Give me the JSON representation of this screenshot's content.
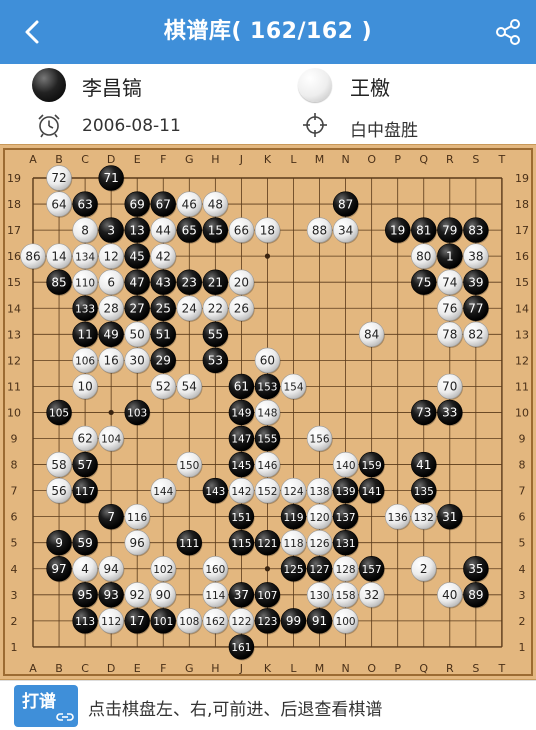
{
  "header": {
    "title": "棋谱库( 162/162 )",
    "back_icon": "chevron-left-icon",
    "share_icon": "share-icon"
  },
  "players": {
    "black": {
      "name": "李昌镐"
    },
    "white": {
      "name": "王檄"
    }
  },
  "game": {
    "date": "2006-08-11",
    "result": "白中盘胜"
  },
  "board": {
    "size": 19,
    "columns": [
      "A",
      "B",
      "C",
      "D",
      "E",
      "F",
      "G",
      "H",
      "J",
      "K",
      "L",
      "M",
      "N",
      "O",
      "P",
      "Q",
      "R",
      "S",
      "T"
    ],
    "rows": [
      "19",
      "18",
      "17",
      "16",
      "15",
      "14",
      "13",
      "12",
      "11",
      "10",
      "9",
      "8",
      "7",
      "6",
      "5",
      "4",
      "3",
      "2",
      "1"
    ],
    "black_stones": [
      {
        "p": "D19",
        "n": "71"
      },
      {
        "p": "C18",
        "n": "63"
      },
      {
        "p": "E18",
        "n": "69"
      },
      {
        "p": "F18",
        "n": "67"
      },
      {
        "p": "N18",
        "n": "87"
      },
      {
        "p": "D17",
        "n": "3"
      },
      {
        "p": "E17",
        "n": "13"
      },
      {
        "p": "G17",
        "n": "65"
      },
      {
        "p": "H17",
        "n": "15"
      },
      {
        "p": "P17",
        "n": "19"
      },
      {
        "p": "Q17",
        "n": "81"
      },
      {
        "p": "R17",
        "n": "79"
      },
      {
        "p": "S17",
        "n": "83"
      },
      {
        "p": "E16",
        "n": "45"
      },
      {
        "p": "R16",
        "n": "1"
      },
      {
        "p": "B15",
        "n": "85"
      },
      {
        "p": "E15",
        "n": "47"
      },
      {
        "p": "F15",
        "n": "43"
      },
      {
        "p": "G15",
        "n": "23"
      },
      {
        "p": "H15",
        "n": "21"
      },
      {
        "p": "Q15",
        "n": "75"
      },
      {
        "p": "S15",
        "n": "39"
      },
      {
        "p": "C14",
        "n": "133"
      },
      {
        "p": "E14",
        "n": "27"
      },
      {
        "p": "F14",
        "n": "25"
      },
      {
        "p": "S14",
        "n": "77"
      },
      {
        "p": "C13",
        "n": "11"
      },
      {
        "p": "D13",
        "n": "49"
      },
      {
        "p": "F13",
        "n": "51"
      },
      {
        "p": "H13",
        "n": "55"
      },
      {
        "p": "F12",
        "n": "29"
      },
      {
        "p": "H12",
        "n": "53"
      },
      {
        "p": "J11",
        "n": "61"
      },
      {
        "p": "K11",
        "n": "153"
      },
      {
        "p": "B10",
        "n": "105"
      },
      {
        "p": "E10",
        "n": "103"
      },
      {
        "p": "J10",
        "n": "149"
      },
      {
        "p": "Q10",
        "n": "73"
      },
      {
        "p": "R10",
        "n": "33"
      },
      {
        "p": "J9",
        "n": "147"
      },
      {
        "p": "K9",
        "n": "155"
      },
      {
        "p": "C8",
        "n": "57"
      },
      {
        "p": "J8",
        "n": "145"
      },
      {
        "p": "O8",
        "n": "159"
      },
      {
        "p": "Q8",
        "n": "41"
      },
      {
        "p": "C7",
        "n": "117"
      },
      {
        "p": "H7",
        "n": "143"
      },
      {
        "p": "N7",
        "n": "139"
      },
      {
        "p": "O7",
        "n": "141"
      },
      {
        "p": "Q7",
        "n": "135"
      },
      {
        "p": "D6",
        "n": "7"
      },
      {
        "p": "J6",
        "n": "151"
      },
      {
        "p": "L6",
        "n": "119"
      },
      {
        "p": "N6",
        "n": "137"
      },
      {
        "p": "R6",
        "n": "31"
      },
      {
        "p": "B5",
        "n": "9"
      },
      {
        "p": "C5",
        "n": "59"
      },
      {
        "p": "G5",
        "n": "111"
      },
      {
        "p": "J5",
        "n": "115"
      },
      {
        "p": "K5",
        "n": "121"
      },
      {
        "p": "N5",
        "n": "131"
      },
      {
        "p": "B4",
        "n": "97"
      },
      {
        "p": "L4",
        "n": "125"
      },
      {
        "p": "M4",
        "n": "127"
      },
      {
        "p": "O4",
        "n": "157"
      },
      {
        "p": "S4",
        "n": "35"
      },
      {
        "p": "C3",
        "n": "95"
      },
      {
        "p": "D3",
        "n": "93"
      },
      {
        "p": "J3",
        "n": "37"
      },
      {
        "p": "K3",
        "n": "107"
      },
      {
        "p": "S3",
        "n": "89"
      },
      {
        "p": "C2",
        "n": "113"
      },
      {
        "p": "E2",
        "n": "17"
      },
      {
        "p": "F2",
        "n": "101"
      },
      {
        "p": "K2",
        "n": "123"
      },
      {
        "p": "L2",
        "n": "99"
      },
      {
        "p": "M2",
        "n": "91"
      },
      {
        "p": "J1",
        "n": "161"
      }
    ],
    "white_stones": [
      {
        "p": "B19",
        "n": "72"
      },
      {
        "p": "B18",
        "n": "64"
      },
      {
        "p": "G18",
        "n": "46"
      },
      {
        "p": "H18",
        "n": "48"
      },
      {
        "p": "C17",
        "n": "8"
      },
      {
        "p": "F17",
        "n": "44"
      },
      {
        "p": "J17",
        "n": "66"
      },
      {
        "p": "K17",
        "n": "18"
      },
      {
        "p": "M17",
        "n": "88"
      },
      {
        "p": "N17",
        "n": "34"
      },
      {
        "p": "A16",
        "n": "86"
      },
      {
        "p": "B16",
        "n": "14"
      },
      {
        "p": "C16",
        "n": "134"
      },
      {
        "p": "D16",
        "n": "12"
      },
      {
        "p": "F16",
        "n": "42"
      },
      {
        "p": "Q16",
        "n": "80"
      },
      {
        "p": "S16",
        "n": "38"
      },
      {
        "p": "C15",
        "n": "110"
      },
      {
        "p": "D15",
        "n": "6"
      },
      {
        "p": "J15",
        "n": "20"
      },
      {
        "p": "R15",
        "n": "74"
      },
      {
        "p": "D14",
        "n": "28"
      },
      {
        "p": "G14",
        "n": "24"
      },
      {
        "p": "H14",
        "n": "22"
      },
      {
        "p": "J14",
        "n": "26"
      },
      {
        "p": "R14",
        "n": "76"
      },
      {
        "p": "E13",
        "n": "50"
      },
      {
        "p": "O13",
        "n": "84"
      },
      {
        "p": "R13",
        "n": "78"
      },
      {
        "p": "S13",
        "n": "82"
      },
      {
        "p": "C12",
        "n": "106"
      },
      {
        "p": "D12",
        "n": "16"
      },
      {
        "p": "E12",
        "n": "30"
      },
      {
        "p": "K12",
        "n": "60"
      },
      {
        "p": "C11",
        "n": "10"
      },
      {
        "p": "F11",
        "n": "52"
      },
      {
        "p": "G11",
        "n": "54"
      },
      {
        "p": "L11",
        "n": "154"
      },
      {
        "p": "R11",
        "n": "70"
      },
      {
        "p": "K10",
        "n": "148"
      },
      {
        "p": "C9",
        "n": "62"
      },
      {
        "p": "D9",
        "n": "104"
      },
      {
        "p": "M9",
        "n": "156"
      },
      {
        "p": "B8",
        "n": "58"
      },
      {
        "p": "G8",
        "n": "150"
      },
      {
        "p": "K8",
        "n": "146"
      },
      {
        "p": "N8",
        "n": "140"
      },
      {
        "p": "B7",
        "n": "56"
      },
      {
        "p": "F7",
        "n": "144"
      },
      {
        "p": "J7",
        "n": "142"
      },
      {
        "p": "K7",
        "n": "152"
      },
      {
        "p": "L7",
        "n": "124"
      },
      {
        "p": "M7",
        "n": "138"
      },
      {
        "p": "E6",
        "n": "116"
      },
      {
        "p": "M6",
        "n": "120"
      },
      {
        "p": "P6",
        "n": "136"
      },
      {
        "p": "Q6",
        "n": "132"
      },
      {
        "p": "E5",
        "n": "96"
      },
      {
        "p": "L5",
        "n": "118"
      },
      {
        "p": "M5",
        "n": "126"
      },
      {
        "p": "C4",
        "n": "4"
      },
      {
        "p": "D4",
        "n": "94"
      },
      {
        "p": "F4",
        "n": "102"
      },
      {
        "p": "H4",
        "n": "160"
      },
      {
        "p": "N4",
        "n": "128"
      },
      {
        "p": "Q4",
        "n": "2"
      },
      {
        "p": "E3",
        "n": "92"
      },
      {
        "p": "F3",
        "n": "90"
      },
      {
        "p": "H3",
        "n": "114"
      },
      {
        "p": "M3",
        "n": "130"
      },
      {
        "p": "N3",
        "n": "158"
      },
      {
        "p": "O3",
        "n": "32"
      },
      {
        "p": "R3",
        "n": "40"
      },
      {
        "p": "D2",
        "n": "112"
      },
      {
        "p": "G2",
        "n": "108"
      },
      {
        "p": "H2",
        "n": "162"
      },
      {
        "p": "J2",
        "n": "122"
      },
      {
        "p": "N2",
        "n": "100"
      }
    ]
  },
  "footer": {
    "button_label": "打谱",
    "hint": "点击棋盘左、右,可前进、后退查看棋谱"
  }
}
